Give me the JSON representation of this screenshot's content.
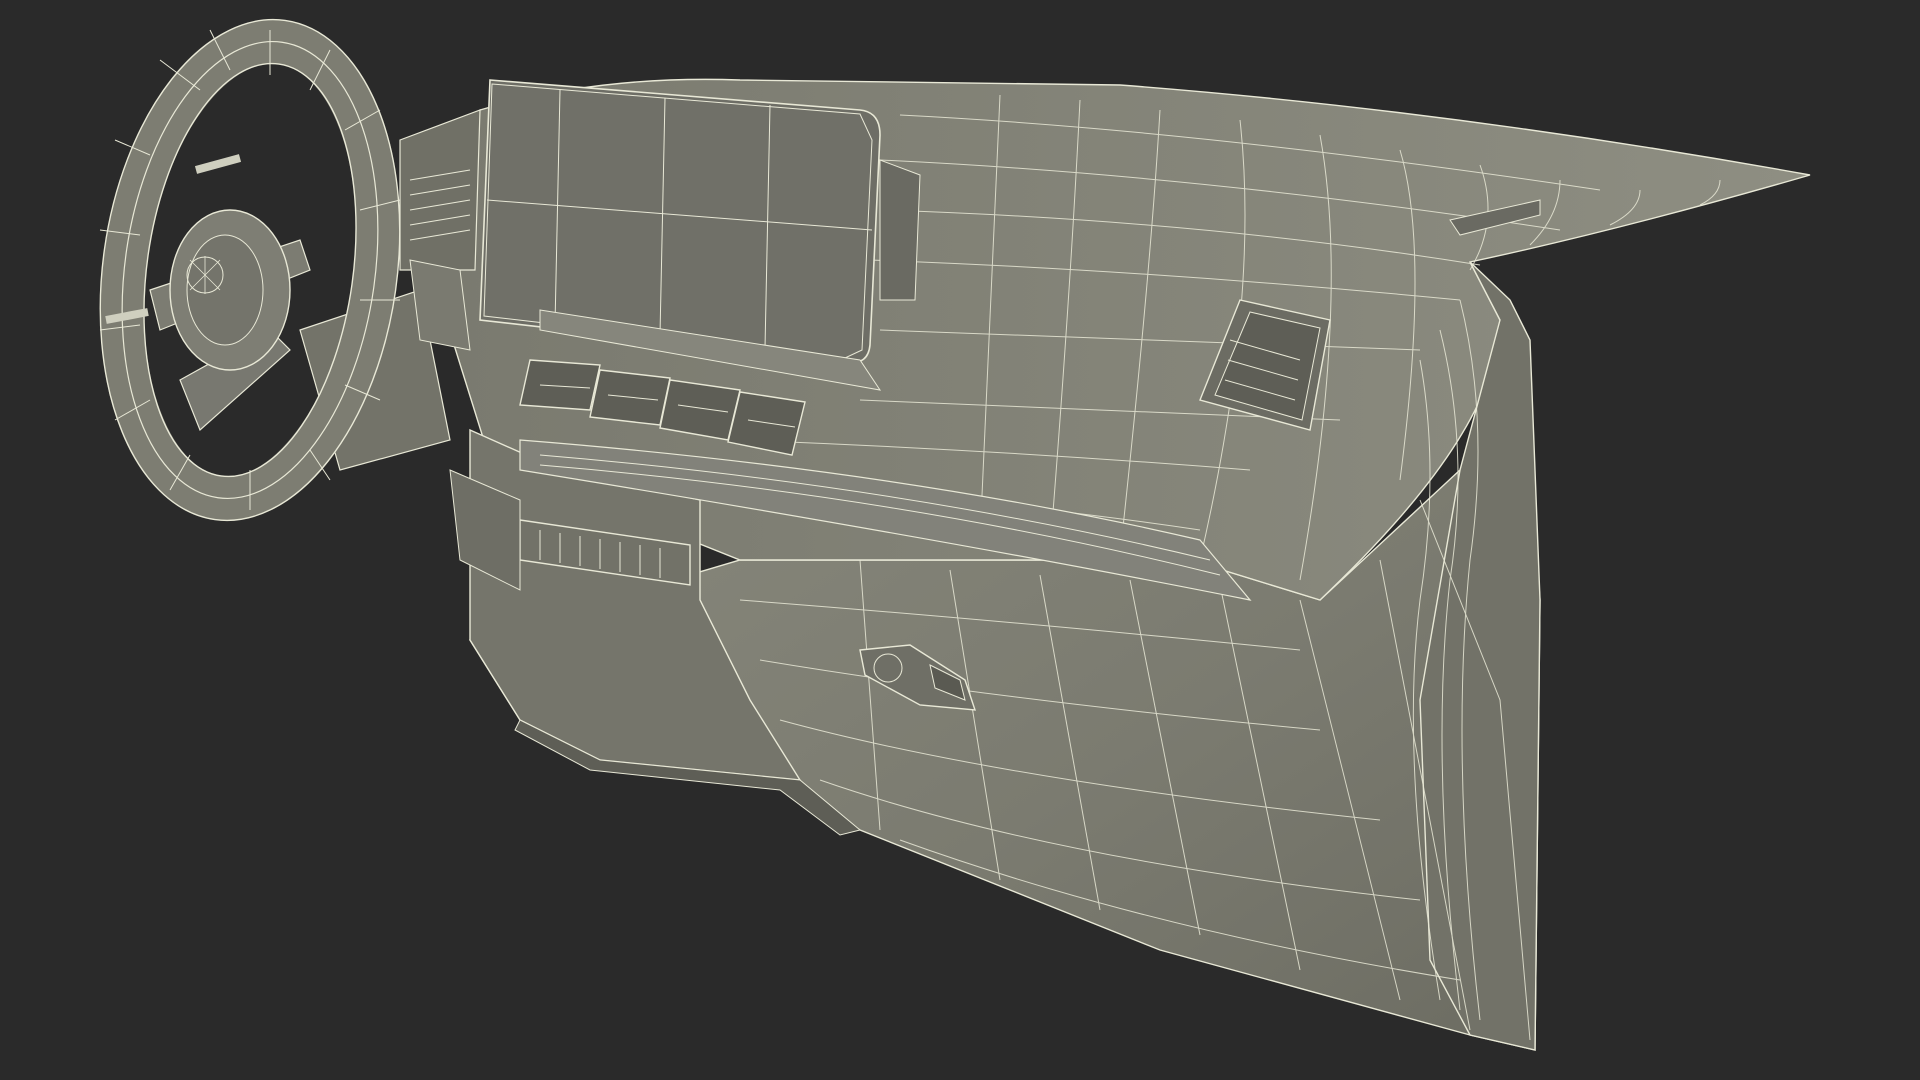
{
  "scene": {
    "subject": "wireframe-dashboard-model",
    "colors": {
      "background": "#2a2a2a",
      "surface": "#7b7b70",
      "surface_light": "#86867a",
      "surface_dark": "#66665c",
      "wire": "#e8e8d6",
      "screen": "#707068"
    },
    "icons": {
      "steering_wheel": "steering-wheel-icon",
      "display": "display-screen-icon",
      "vent": "air-vent-icon",
      "glovebox_handle": "handle-icon"
    }
  }
}
